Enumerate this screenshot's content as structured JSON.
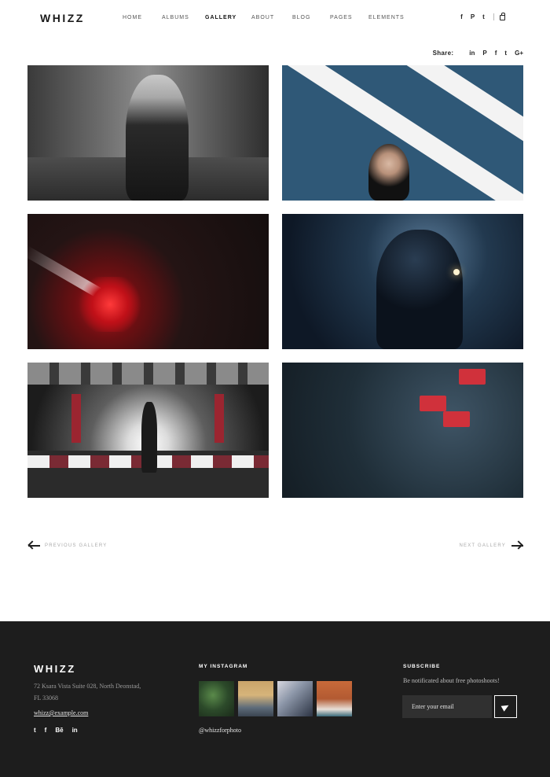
{
  "brand": {
    "logo": "WHIZZ"
  },
  "nav": {
    "items": [
      {
        "label": "HOME"
      },
      {
        "label": "ALBUMS"
      },
      {
        "label": "GALLERY",
        "active": true
      },
      {
        "label": "ABOUT"
      },
      {
        "label": "BLOG"
      },
      {
        "label": "PAGES"
      },
      {
        "label": "ELEMENTS"
      }
    ]
  },
  "header_social": {
    "icons": [
      {
        "name": "facebook-icon",
        "glyph": "f"
      },
      {
        "name": "pinterest-icon",
        "glyph": "P"
      },
      {
        "name": "twitter-icon",
        "glyph": "t"
      }
    ],
    "cart_icon": "shopping-bag-icon"
  },
  "share": {
    "label": "Share:",
    "icons": [
      {
        "name": "linkedin-icon",
        "glyph": "in"
      },
      {
        "name": "pinterest-icon",
        "glyph": "P"
      },
      {
        "name": "facebook-icon",
        "glyph": "f"
      },
      {
        "name": "twitter-icon",
        "glyph": "t"
      },
      {
        "name": "google-plus-icon",
        "glyph": "G+"
      }
    ]
  },
  "gallery": {
    "photos": [
      {
        "name": "photo-woman-street"
      },
      {
        "name": "photo-woman-striped-wall"
      },
      {
        "name": "photo-child-red-light"
      },
      {
        "name": "photo-silhouette-blue"
      },
      {
        "name": "photo-dancer-parking"
      },
      {
        "name": "photo-rickshaws-rain"
      }
    ]
  },
  "pager": {
    "prev_label": "PREVIOUS GALLERY",
    "next_label": "NEXT GALLERY"
  },
  "footer": {
    "logo": "WHIZZ",
    "address_line1": "72 Ksara Vista Suite 028, North Deonstad,",
    "address_line2": "FL 33068",
    "email": "whizz@example.com",
    "social": [
      {
        "name": "twitter-icon",
        "glyph": "t"
      },
      {
        "name": "facebook-icon",
        "glyph": "f"
      },
      {
        "name": "behance-icon",
        "glyph": "Bē"
      },
      {
        "name": "linkedin-icon",
        "glyph": "in"
      }
    ],
    "instagram_title": "MY INSTAGRAM",
    "instagram_handle": "@whizzforphoto",
    "subscribe_title": "SUBSCRIBE",
    "subscribe_text": "Be notificated about free photoshoots!",
    "email_placeholder": "Enter your email",
    "send_icon": "paper-plane-icon"
  },
  "colors": {
    "footer_bg": "#1d1d1d",
    "text_dark": "#222222",
    "muted": "#aaaaaa"
  }
}
